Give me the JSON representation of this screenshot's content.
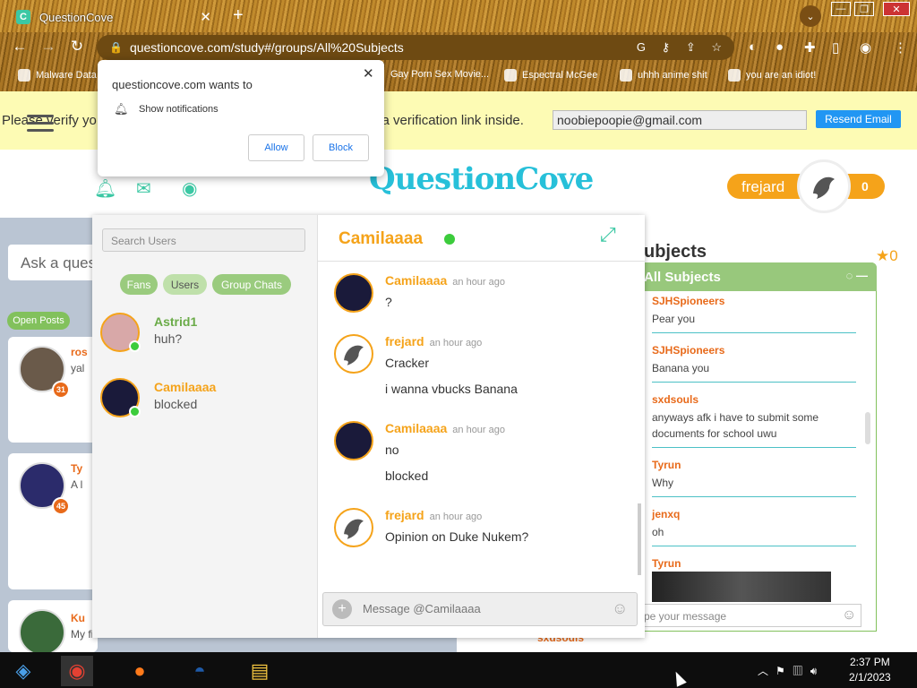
{
  "browser": {
    "tab_title": "QuestionCove",
    "tab_favicon": "C",
    "url": "questioncove.com/study#/groups/All%20Subjects",
    "bookmarks": [
      {
        "label": "Malware Data"
      },
      {
        "label": "Gay Porn Sex Movie..."
      },
      {
        "label": "Espectral McGee"
      },
      {
        "label": "uhhh anime shit"
      },
      {
        "label": "you are an idiot!"
      }
    ]
  },
  "notification_popup": {
    "title": "questioncove.com wants to",
    "permission": "Show notifications",
    "allow_label": "Allow",
    "block_label": "Block"
  },
  "verify_bar": {
    "text_left": "Please verify yo",
    "text_right": "n a verification link inside.",
    "email": "noobiepoopie@gmail.com",
    "resend_label": "Resend Email"
  },
  "header": {
    "logo_left": "Question",
    "logo_right": "Cove",
    "username": "frejard",
    "score": "0"
  },
  "left_feed": {
    "ask_placeholder": "Ask a ques",
    "open_posts_label": "Open Posts",
    "posts": [
      {
        "user": "ros",
        "snippet": "yal",
        "badge": "31"
      },
      {
        "user": "Ty",
        "snippet": "A l",
        "badge": "45"
      },
      {
        "user": "Ku",
        "snippet": "My first ask here",
        "badge": ""
      }
    ]
  },
  "subjects": {
    "title": "ubjects",
    "count": "0",
    "chat_title": "All Subjects",
    "messages": [
      {
        "user": "SJHSpioneers",
        "text": "Pear you"
      },
      {
        "user": "SJHSpioneers",
        "text": "Banana you"
      },
      {
        "user": "sxdsouls",
        "text": "anyways afk i have to submit some documents for school uwu"
      },
      {
        "user": "Tyrun",
        "text": "Why"
      },
      {
        "user": "jenxq",
        "text": "oh"
      },
      {
        "user": "Tyrun",
        "text": ""
      }
    ],
    "input_placeholder": "pe your message",
    "below_user": "sxdsouls"
  },
  "dm": {
    "search_placeholder": "Search Users",
    "tabs": [
      "Fans",
      "Users",
      "Group Chats"
    ],
    "conversations": [
      {
        "name": "Astrid1",
        "preview": "huh?",
        "name_color": "#6aab48"
      },
      {
        "name": "Camilaaaa",
        "preview": "blocked",
        "name_color": "#f5a31a"
      }
    ],
    "active_name": "Camilaaaa",
    "messages": [
      {
        "user": "Camilaaaa",
        "time": "an hour ago",
        "lines": [
          "?"
        ]
      },
      {
        "user": "frejard",
        "time": "an hour ago",
        "lines": [
          "Cracker",
          "i wanna vbucks Banana"
        ]
      },
      {
        "user": "Camilaaaa",
        "time": "an hour ago",
        "lines": [
          "no",
          "blocked"
        ]
      },
      {
        "user": "frejard",
        "time": "an hour ago",
        "lines": [
          "Opinion on Duke Nukem?"
        ]
      }
    ],
    "composer_placeholder": "Message @Camilaaaa"
  },
  "taskbar": {
    "time": "2:37 PM",
    "date": "2/1/2023"
  },
  "colors": {
    "orange": "#f5a31a",
    "green": "#82c15c",
    "teal": "#3cc8a4"
  }
}
